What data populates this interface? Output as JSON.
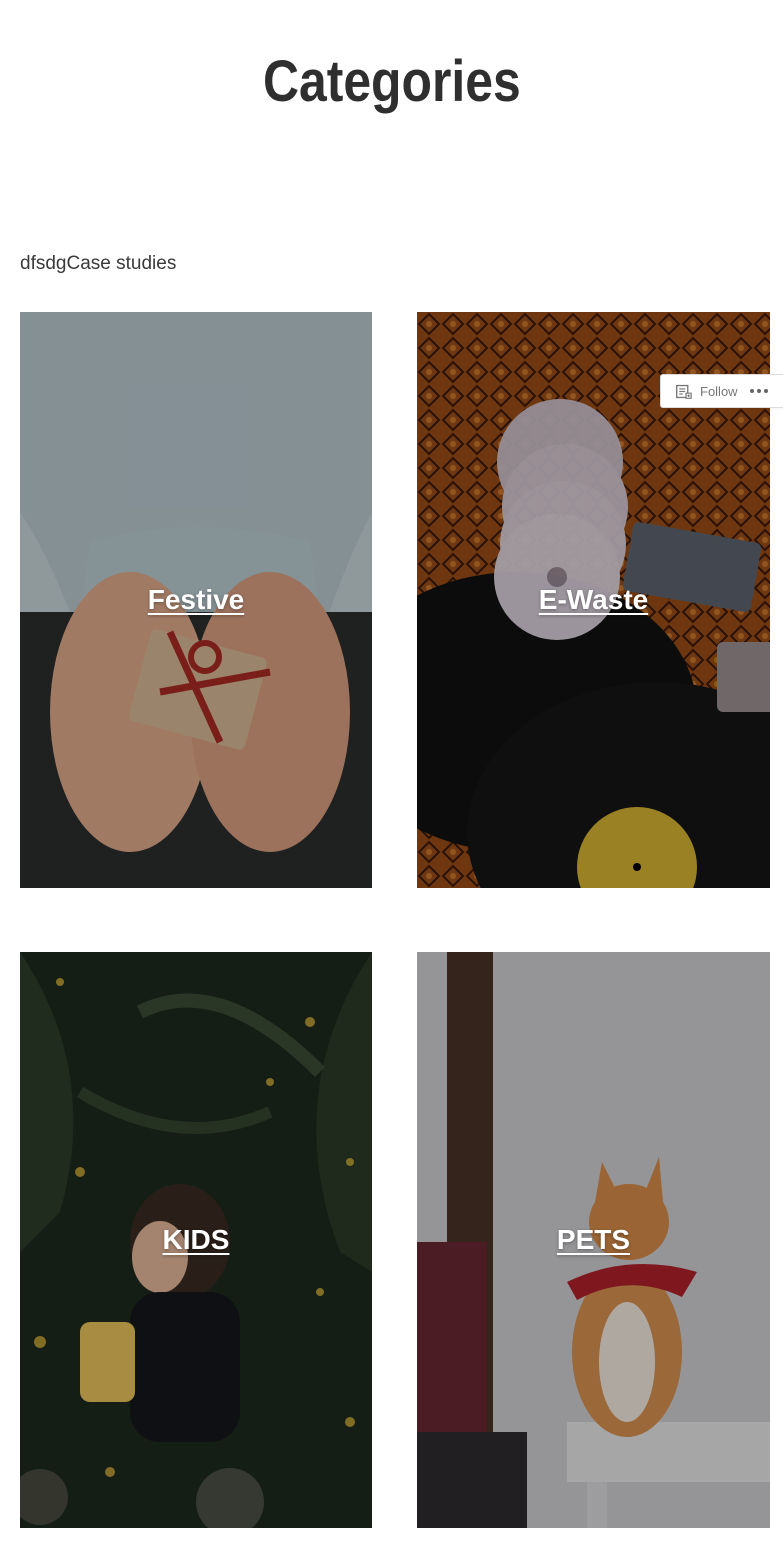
{
  "page": {
    "title": "Categories",
    "subtitle": "dfsdgCase studies"
  },
  "categories": [
    {
      "label": "Festive",
      "image": "hands-holding-gift-photo"
    },
    {
      "label": "E-Waste",
      "image": "cds-cassettes-vinyl-photo"
    },
    {
      "label": "KIDS",
      "image": "child-with-light-jar-photo"
    },
    {
      "label": "PETS",
      "image": "cat-with-bandana-photo"
    }
  ],
  "follow_widget": {
    "follow_label": "Follow",
    "icons": [
      "reader-icon",
      "more-ellipsis-icon"
    ]
  },
  "colors": {
    "title": "#2f2f2f",
    "text": "#3a3a3a",
    "overlay": "rgba(0,0,0,0.28)",
    "label": "#ffffff"
  }
}
